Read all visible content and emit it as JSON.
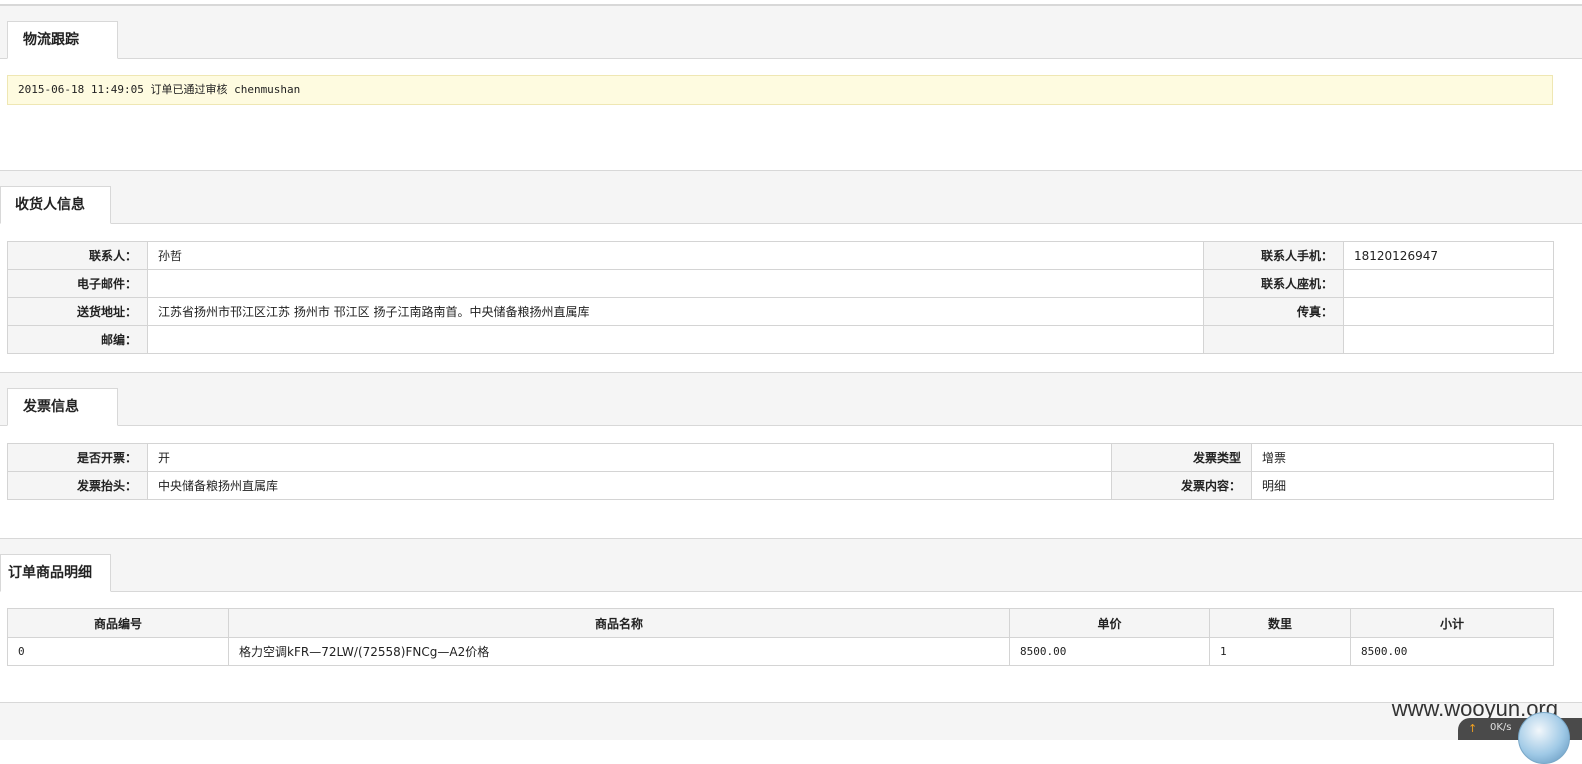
{
  "logistics": {
    "tab_label": "物流跟踪",
    "record": "2015-06-18 11:49:05 订单已通过审核 chenmushan"
  },
  "consignee": {
    "tab_label": "收货人信息",
    "rows": [
      {
        "label1": "联系人：",
        "value1": "孙哲",
        "label2": "联系人手机：",
        "value2": "18120126947"
      },
      {
        "label1": "电子邮件：",
        "value1": "",
        "label2": "联系人座机：",
        "value2": ""
      },
      {
        "label1": "送货地址：",
        "value1": "江苏省扬州市邗江区江苏 扬州市 邗江区 扬子江南路南首。中央储备粮扬州直属库",
        "label2": "传真：",
        "value2": ""
      },
      {
        "label1": "邮编：",
        "value1": "",
        "label2": "",
        "value2": ""
      }
    ]
  },
  "invoice": {
    "tab_label": "发票信息",
    "rows": [
      {
        "label1": "是否开票：",
        "value1": "开",
        "label2": "发票类型",
        "value2": "增票"
      },
      {
        "label1": "发票抬头：",
        "value1": "中央储备粮扬州直属库",
        "label2": "发票内容：",
        "value2": "明细"
      }
    ]
  },
  "goods": {
    "tab_label": "订单商品明细",
    "headers": [
      "商品编号",
      "商品名称",
      "单价",
      "数里",
      "小计"
    ],
    "rows": [
      {
        "code": "0",
        "name": "格力空调kFR—72LW/(72558)FNCg—A2价格",
        "price": "8500.00",
        "qty": "1",
        "subtotal": "8500.00"
      }
    ]
  },
  "watermark": "www.wooyun.org",
  "net_widget": {
    "speed": "0K/s"
  }
}
